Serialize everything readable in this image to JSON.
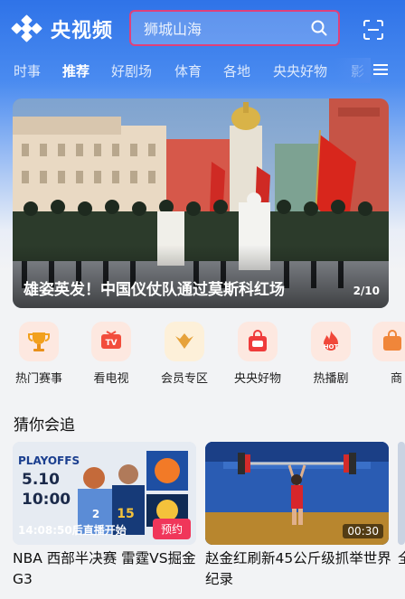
{
  "header": {
    "app_name": "央视频",
    "search_placeholder": "狮城山海"
  },
  "tabs": [
    "时事",
    "推荐",
    "好剧场",
    "体育",
    "各地",
    "央央好物",
    "影"
  ],
  "active_tab": "推荐",
  "banner": {
    "title": "雄姿英发！中国仪仗队通过莫斯科红场",
    "page": "2/10"
  },
  "quick_entries": [
    {
      "label": "热门赛事",
      "icon": "trophy-icon"
    },
    {
      "label": "看电视",
      "icon": "tv-icon"
    },
    {
      "label": "会员专区",
      "icon": "vip-icon"
    },
    {
      "label": "央央好物",
      "icon": "shop-bag-icon"
    },
    {
      "label": "热播剧",
      "icon": "hot-icon"
    },
    {
      "label": "商",
      "icon": "mall-icon"
    }
  ],
  "section": {
    "title": "猜你会追"
  },
  "cards": [
    {
      "title": "NBA 西部半决赛 雷霆VS掘金G3",
      "time": "14:08:50后直播开始",
      "button": "预约",
      "poster_date": "5.10",
      "poster_time": "10:00",
      "poster_brand": "PLAYOFFS"
    },
    {
      "title": "赵金红刷新45公斤级抓举世界纪录",
      "duration": "00:30"
    },
    {
      "title": "全"
    }
  ],
  "colors": {
    "brand_blue": "#2f73e8",
    "search_border": "#e0407a",
    "book_red": "#f0365a"
  }
}
